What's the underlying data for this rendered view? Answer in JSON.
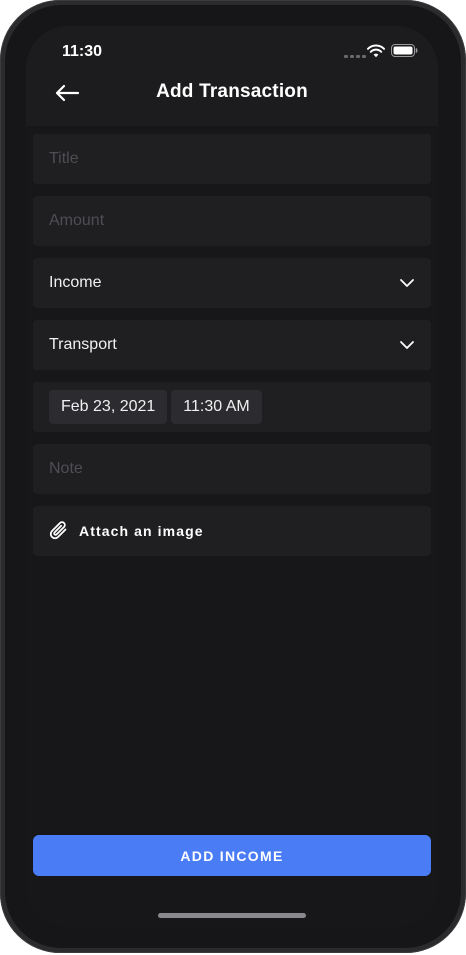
{
  "status_bar": {
    "time": "11:30",
    "icons": [
      "signal-icon",
      "wifi-icon",
      "battery-icon"
    ]
  },
  "header": {
    "back_icon": "arrow-left-icon",
    "title": "Add Transaction"
  },
  "form": {
    "title_placeholder": "Title",
    "amount_placeholder": "Amount",
    "type_select": {
      "value": "Income",
      "icon": "chevron-down-icon"
    },
    "category_select": {
      "value": "Transport",
      "icon": "chevron-down-icon"
    },
    "date": "Feb 23, 2021",
    "time": "11:30 AM",
    "note_placeholder": "Note",
    "attach": {
      "icon": "paperclip-icon",
      "label": "Attach an image"
    }
  },
  "submit": {
    "label": "ADD INCOME"
  },
  "colors": {
    "background": "#171719",
    "field": "#1f1f22",
    "accent": "#4a7cf6",
    "placeholder": "#4e4e53"
  }
}
